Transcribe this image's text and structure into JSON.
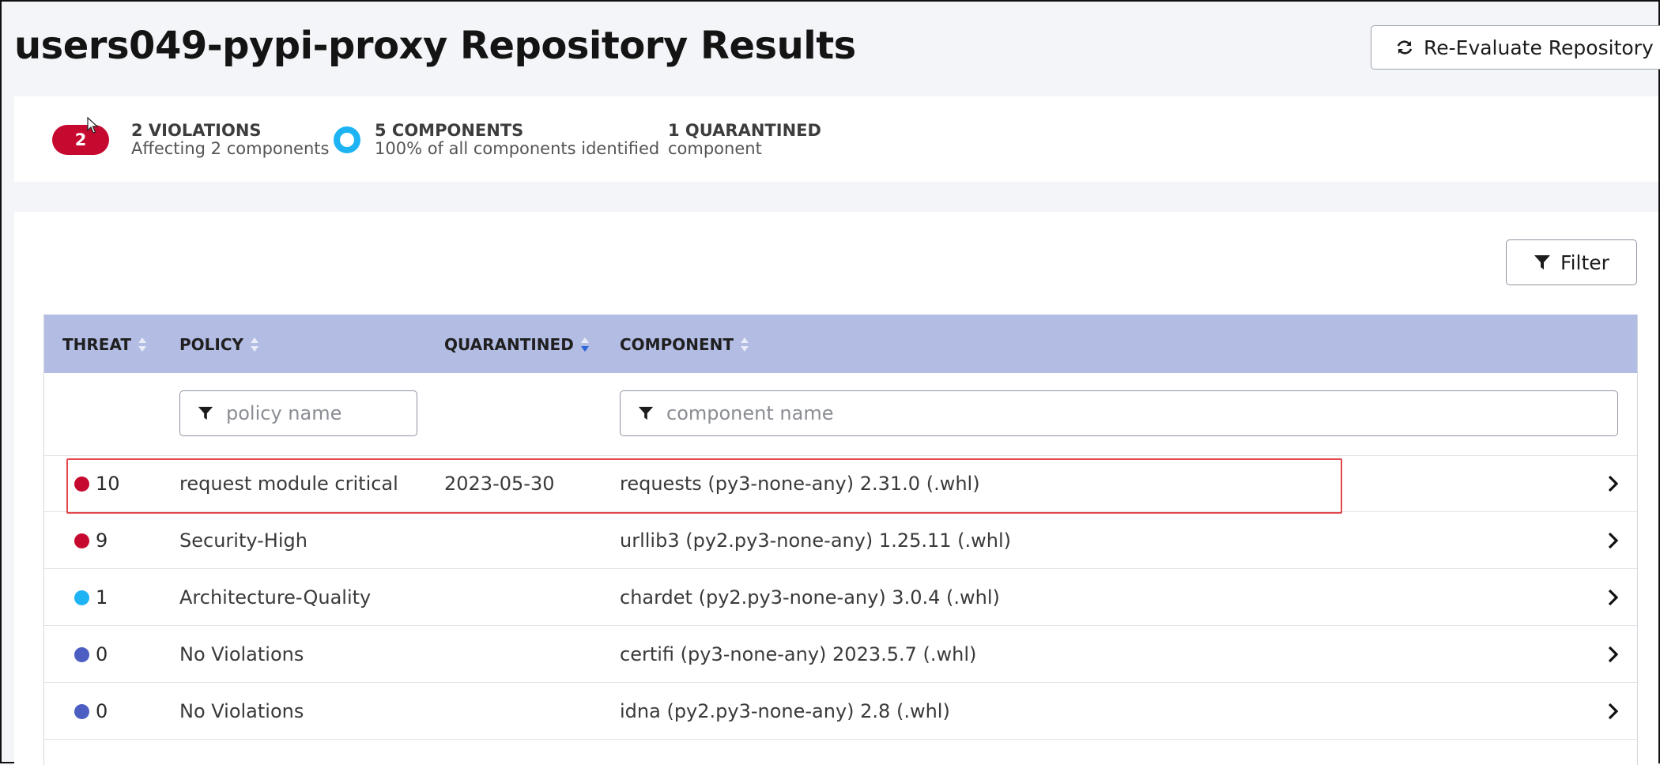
{
  "header": {
    "title": "users049-pypi-proxy Repository Results",
    "reevaluate_label": "Re-Evaluate Repository"
  },
  "summary": {
    "violations_count": "2",
    "violations_title": "2 VIOLATIONS",
    "violations_sub": "Affecting 2 components",
    "components_title": "5 COMPONENTS",
    "components_sub": "100% of all components identified",
    "quarantined_title": "1 QUARANTINED",
    "quarantined_sub": "component"
  },
  "toolbar": {
    "filter_label": "Filter"
  },
  "table": {
    "headers": {
      "threat": "THREAT",
      "policy": "POLICY",
      "quarantined": "QUARANTINED",
      "component": "COMPONENT"
    },
    "policy_placeholder": "policy name",
    "component_placeholder": "component name",
    "rows": [
      {
        "threat": "10",
        "policy": "request module critical",
        "quarantined": "2023-05-30",
        "component": "requests (py3-none-any) 2.31.0 (.whl)"
      },
      {
        "threat": "9",
        "policy": "Security-High",
        "quarantined": "",
        "component": "urllib3 (py2.py3-none-any) 1.25.11 (.whl)"
      },
      {
        "threat": "1",
        "policy": "Architecture-Quality",
        "quarantined": "",
        "component": "chardet (py2.py3-none-any) 3.0.4 (.whl)"
      },
      {
        "threat": "0",
        "policy": "No Violations",
        "quarantined": "",
        "component": "certifi (py3-none-any) 2023.5.7 (.whl)"
      },
      {
        "threat": "0",
        "policy": "No Violations",
        "quarantined": "",
        "component": "idna (py2.py3-none-any) 2.8 (.whl)"
      }
    ]
  },
  "colors": {
    "critical": "#c6092f",
    "low": "#1eb4f3",
    "none": "#4d5ec3",
    "header_bg": "#b3bce3",
    "highlight": "#e2474c"
  },
  "icons": {
    "reevaluate": "refresh-icon",
    "filter": "filter-icon",
    "sort": "sort-icon",
    "row_open": "chevron-right-icon"
  }
}
